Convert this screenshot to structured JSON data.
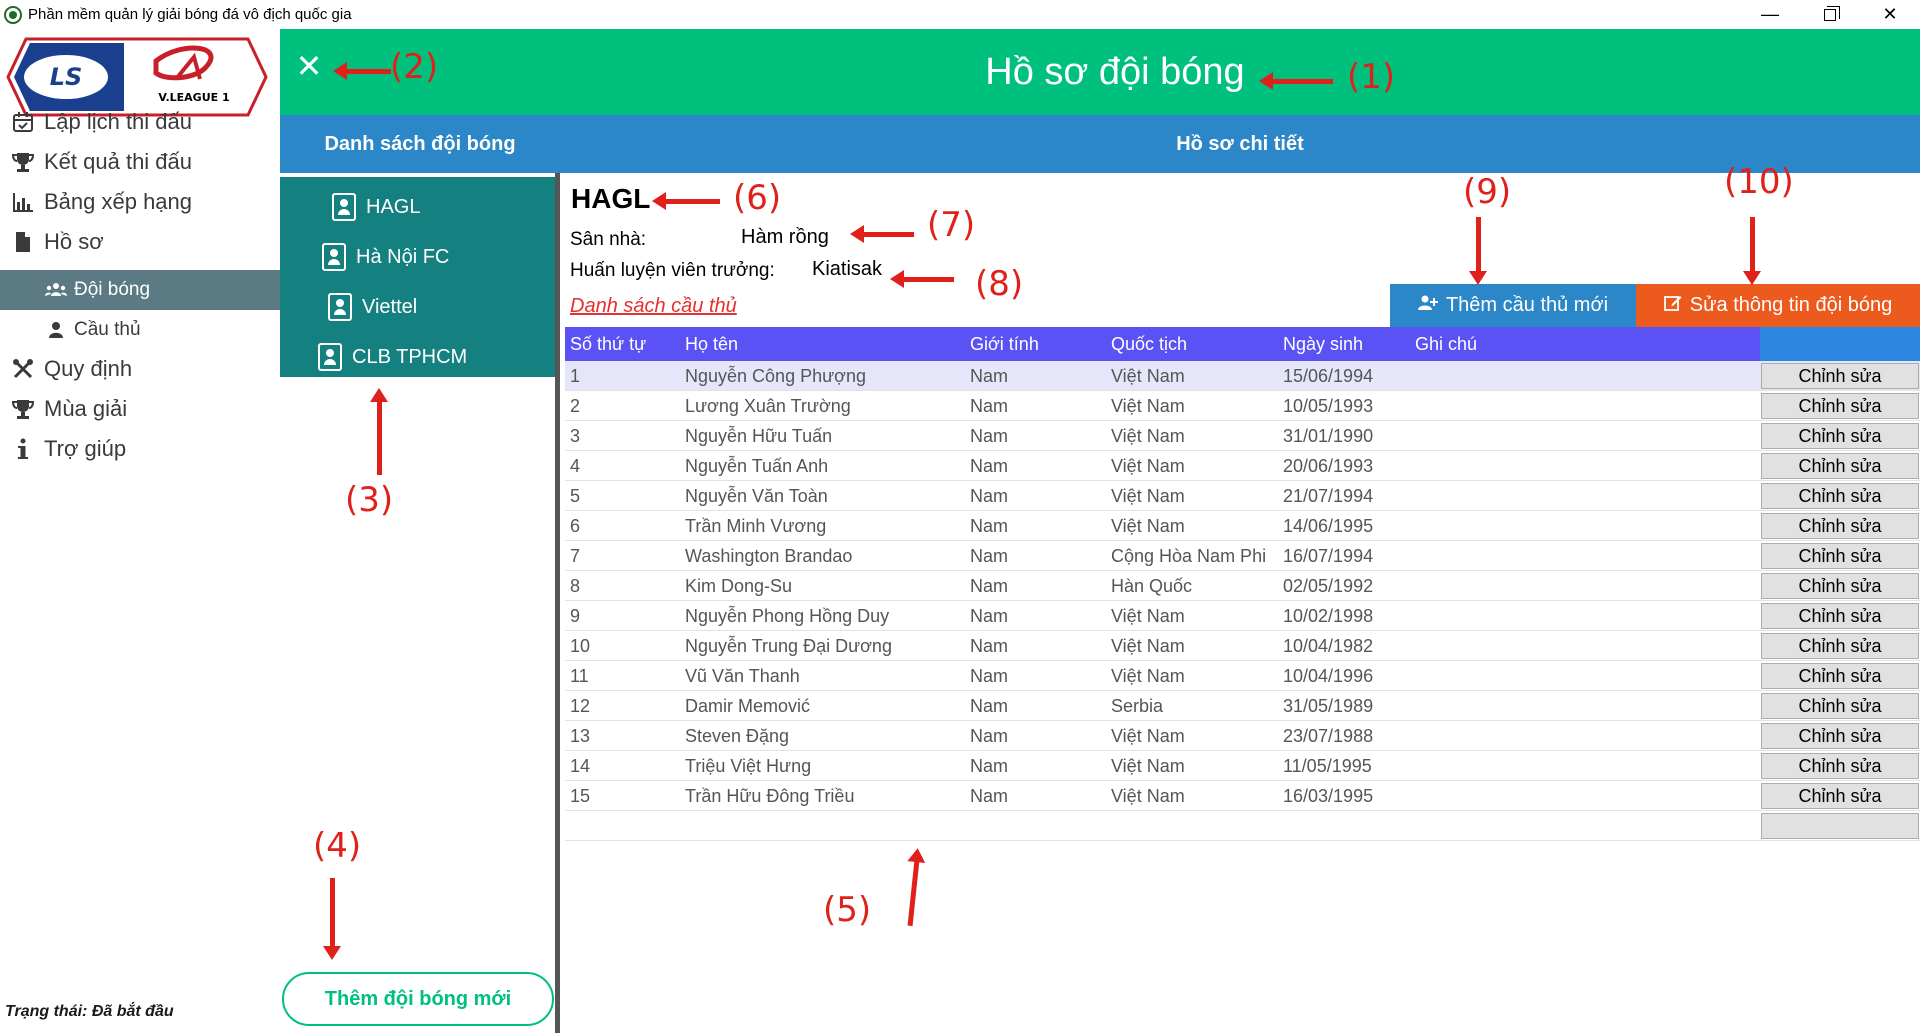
{
  "window": {
    "title": "Phần mềm quản lý giải bóng đá vô địch quốc gia",
    "minimize_glyph": "—",
    "close_glyph": "✕"
  },
  "logo": {
    "left_text": "LS",
    "right_text": "V.LEAGUE 1"
  },
  "nav": {
    "items": [
      {
        "label": "Lập lịch thi đấu",
        "icon": "calendar-check-icon"
      },
      {
        "label": "Kết quả thi đấu",
        "icon": "trophy-icon"
      },
      {
        "label": "Bảng xếp hạng",
        "icon": "bar-chart-icon"
      },
      {
        "label": "Hồ sơ",
        "icon": "file-icon"
      },
      {
        "label": "Đội bóng",
        "icon": "users-icon"
      },
      {
        "label": "Cầu thủ",
        "icon": "user-icon"
      },
      {
        "label": "Quy định",
        "icon": "tools-icon"
      },
      {
        "label": "Mùa giải",
        "icon": "trophy-icon"
      },
      {
        "label": "Trợ giúp",
        "icon": "info-icon"
      }
    ],
    "active": "Đội bóng",
    "status": "Trạng thái: Đã bắt đầu"
  },
  "header": {
    "close_glyph": "✕",
    "title": "Hồ sơ đội bóng"
  },
  "subheader": {
    "left": "Danh sách đội bóng",
    "right": "Hồ sơ chi tiết"
  },
  "teams": [
    "HAGL",
    "Hà Nội FC",
    "Viettel",
    "CLB TPHCM"
  ],
  "add_team_label": "Thêm đội bóng mới",
  "detail": {
    "team_name": "HAGL",
    "stadium_label": "Sân nhà:",
    "stadium_value": "Hàm rồng",
    "coach_label": "Huấn luyện viên trưởng:",
    "coach_value": "Kiatisak",
    "players_link": "Danh sách cầu thủ",
    "add_player_label": "Thêm cầu thủ mới",
    "edit_team_label": "Sửa thông tin đội bóng"
  },
  "table": {
    "headers": [
      "Số thứ tự",
      "Họ tên",
      "Giới tính",
      "Quốc tịch",
      "Ngày sinh",
      "Ghi chú"
    ],
    "action_label": "Chỉnh sửa",
    "rows": [
      [
        "1",
        "Nguyễn Công Phượng",
        "Nam",
        "Việt Nam",
        "15/06/1994",
        ""
      ],
      [
        "2",
        "Lương Xuân Trường",
        "Nam",
        "Việt Nam",
        "10/05/1993",
        ""
      ],
      [
        "3",
        "Nguyễn Hữu Tuấn",
        "Nam",
        "Việt Nam",
        "31/01/1990",
        ""
      ],
      [
        "4",
        "Nguyễn Tuấn Anh",
        "Nam",
        "Việt Nam",
        "20/06/1993",
        ""
      ],
      [
        "5",
        "Nguyễn Văn Toàn",
        "Nam",
        "Việt Nam",
        "21/07/1994",
        ""
      ],
      [
        "6",
        "Trần Minh Vương",
        "Nam",
        "Việt Nam",
        "14/06/1995",
        ""
      ],
      [
        "7",
        "Washington Brandao",
        "Nam",
        "Cộng Hòa Nam Phi",
        "16/07/1994",
        ""
      ],
      [
        "8",
        "Kim Dong-Su",
        "Nam",
        "Hàn Quốc",
        "02/05/1992",
        ""
      ],
      [
        "9",
        "Nguyễn Phong Hồng Duy",
        "Nam",
        "Việt Nam",
        "10/02/1998",
        ""
      ],
      [
        "10",
        "Nguyễn Trung Đại Dương",
        "Nam",
        "Việt Nam",
        "10/04/1982",
        ""
      ],
      [
        "11",
        "Vũ Văn Thanh",
        "Nam",
        "Việt Nam",
        "10/04/1996",
        ""
      ],
      [
        "12",
        "Damir Memović",
        "Nam",
        "Serbia",
        "31/05/1989",
        ""
      ],
      [
        "13",
        "Steven Đặng",
        "Nam",
        "Việt Nam",
        "23/07/1988",
        ""
      ],
      [
        "14",
        "Triệu Việt Hưng",
        "Nam",
        "Việt Nam",
        "11/05/1995",
        ""
      ],
      [
        "15",
        "Trần Hữu Đông Triều",
        "Nam",
        "Việt Nam",
        "16/03/1995",
        ""
      ]
    ]
  },
  "annotations": [
    "(1)",
    "(2)",
    "(3)",
    "(4)",
    "(5)",
    "(6)",
    "(7)",
    "(8)",
    "(9)",
    "(10)"
  ],
  "colors": {
    "header_green": "#00c07e",
    "subheader_blue": "#2b87c7",
    "team_list_teal": "#148080",
    "nav_active": "#5b7a84",
    "table_header": "#5a52f5",
    "edit_orange": "#ec5a1e",
    "annotation_red": "#e0201a"
  }
}
